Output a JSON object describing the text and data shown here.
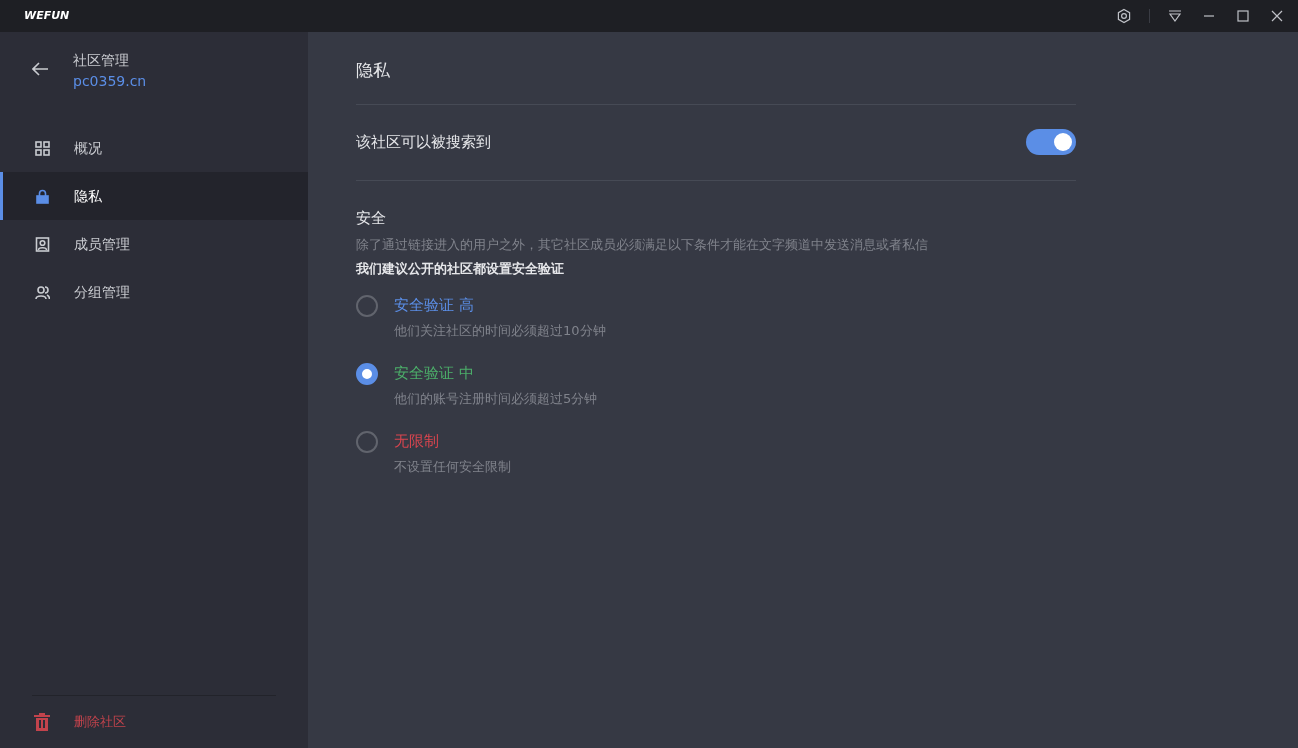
{
  "window": {
    "title": "WEFUN"
  },
  "sidebar": {
    "header": {
      "title": "社区管理",
      "community": "pc0359.cn"
    },
    "items": [
      {
        "label": "概况",
        "selected": false
      },
      {
        "label": "隐私",
        "selected": true
      },
      {
        "label": "成员管理",
        "selected": false
      },
      {
        "label": "分组管理",
        "selected": false
      }
    ],
    "delete": "删除社区"
  },
  "main": {
    "title": "隐私",
    "searchable": {
      "label": "该社区可以被搜索到",
      "on": true
    },
    "security": {
      "title": "安全",
      "description": "除了通过链接进入的用户之外，其它社区成员必须满足以下条件才能在文字频道中发送消息或者私信",
      "recommendation": "我们建议公开的社区都设置安全验证",
      "options": [
        {
          "label": "安全验证 高",
          "hint": "他们关注社区的时间必须超过10分钟",
          "color": "#5b8ee6",
          "selected": false
        },
        {
          "label": "安全验证 中",
          "hint": "他们的账号注册时间必须超过5分钟",
          "color": "#4caf6a",
          "selected": true
        },
        {
          "label": "无限制",
          "hint": "不设置任何安全限制",
          "color": "#d9454f",
          "selected": false
        }
      ]
    }
  }
}
